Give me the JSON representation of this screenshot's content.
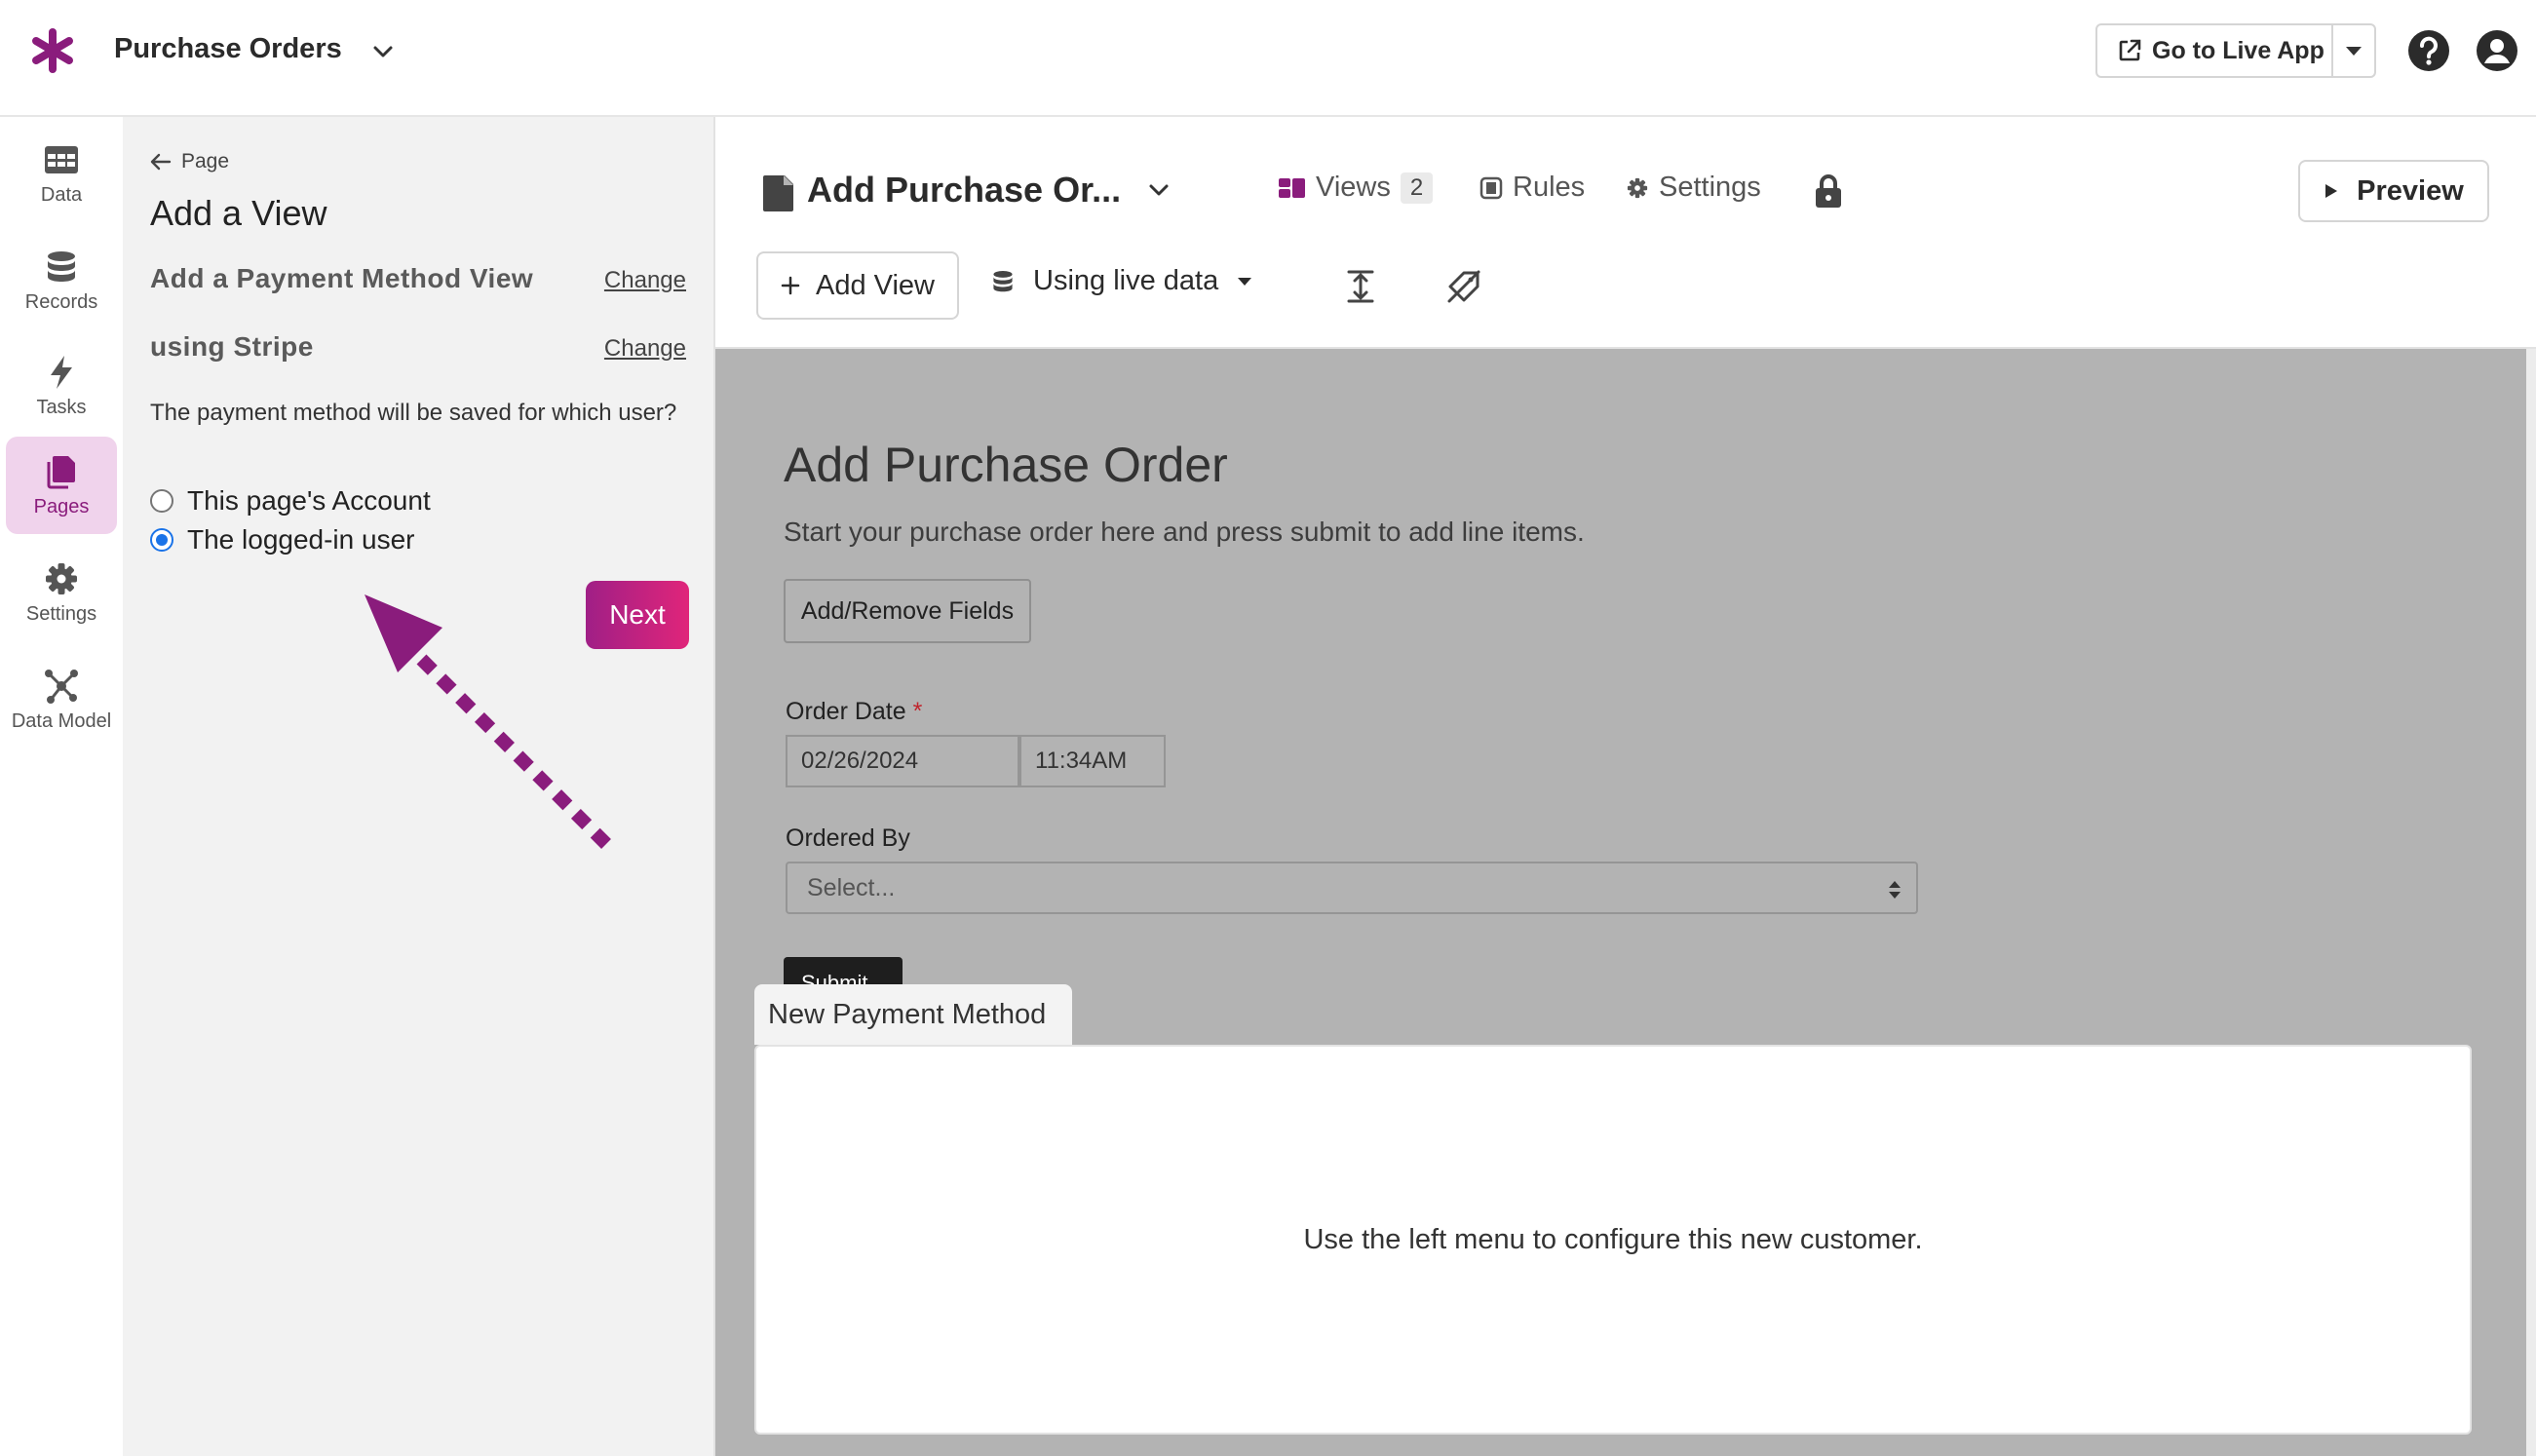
{
  "app": {
    "title": "Purchase Orders",
    "go_live_label": "Go to Live App",
    "brand_color": "#8a1c7c"
  },
  "nav": {
    "items": [
      {
        "label": "Data",
        "icon": "table-icon"
      },
      {
        "label": "Records",
        "icon": "database-icon"
      },
      {
        "label": "Tasks",
        "icon": "lightning-icon"
      },
      {
        "label": "Pages",
        "icon": "pages-icon",
        "active": true
      },
      {
        "label": "Settings",
        "icon": "gear-icon"
      },
      {
        "label": "Data Model",
        "icon": "graph-icon"
      }
    ]
  },
  "panel": {
    "back_label": "Page",
    "title": "Add a View",
    "view_type": "Add a Payment Method View",
    "processor": "using Stripe",
    "change_label": "Change",
    "question": "The payment method will be saved for which user?",
    "options": [
      {
        "label": "This page's Account",
        "checked": false
      },
      {
        "label": "The logged-in user",
        "checked": true
      }
    ],
    "next_label": "Next"
  },
  "toolbar": {
    "page_name": "Add Purchase Or...",
    "views_label": "Views",
    "views_count": "2",
    "rules_label": "Rules",
    "settings_label": "Settings",
    "preview_label": "Preview",
    "add_view_label": "Add View",
    "data_source_label": "Using live data"
  },
  "form": {
    "title": "Add Purchase Order",
    "description": "Start your purchase order here and press submit to add line items.",
    "add_remove_label": "Add/Remove Fields",
    "order_date_label": "Order Date",
    "required_mark": "*",
    "date_value": "02/26/2024",
    "time_value": "11:34AM",
    "ordered_by_label": "Ordered By",
    "ordered_by_placeholder": "Select...",
    "submit_label": "Submit"
  },
  "payment_view": {
    "tab_label": "New Payment Method",
    "message": "Use the left menu to configure this new customer."
  }
}
